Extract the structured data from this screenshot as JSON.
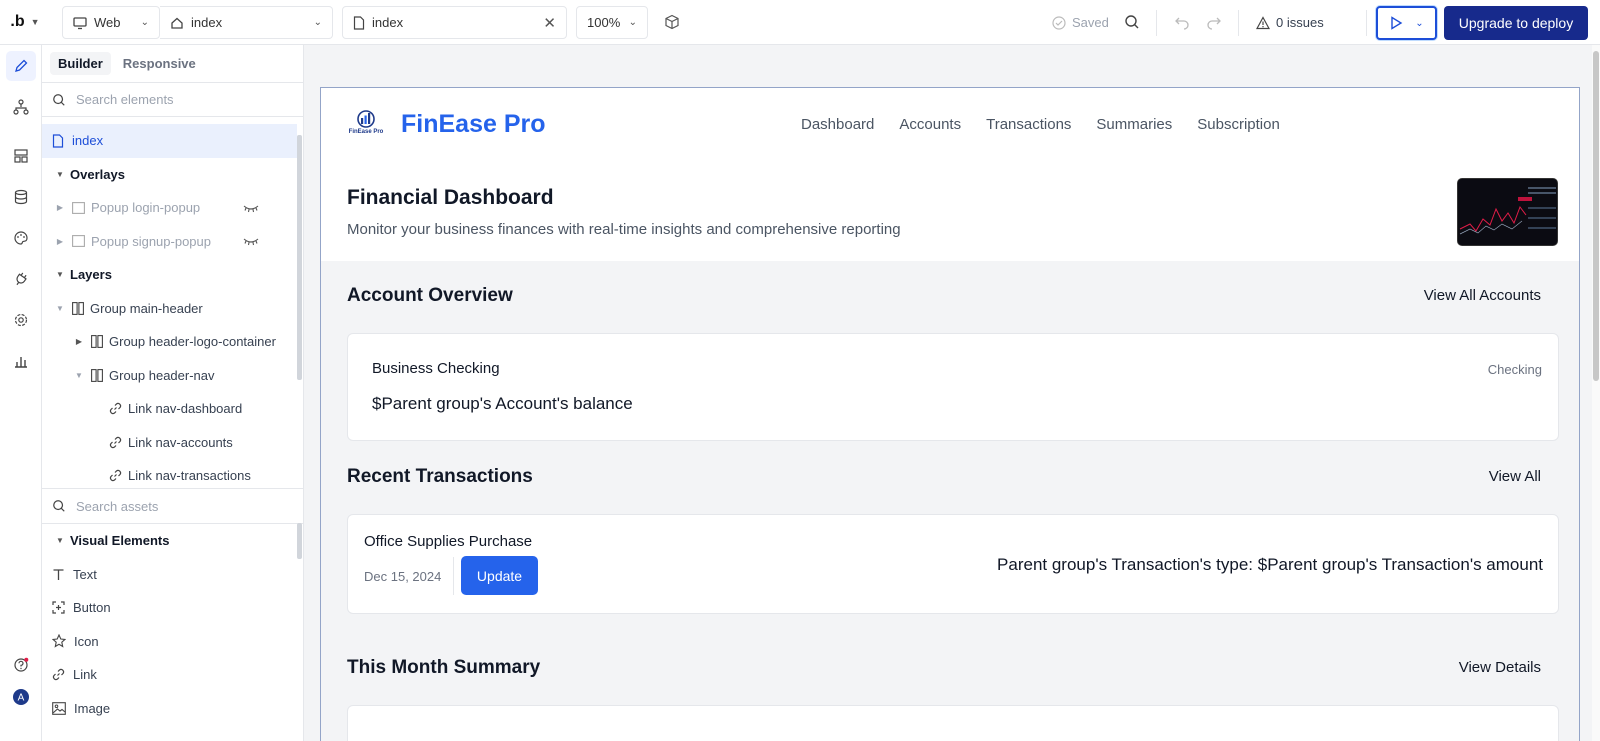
{
  "topbar": {
    "platform": "Web",
    "page_select": "index",
    "page_tab": "index",
    "zoom": "100%",
    "saved": "Saved",
    "issues": "0 issues",
    "deploy": "Upgrade to deploy"
  },
  "panel": {
    "tabs": [
      "Builder",
      "Responsive"
    ],
    "search_placeholder": "Search elements",
    "index": "index",
    "overlays": "Overlays",
    "popup_login": "Popup login-popup",
    "popup_signup": "Popup signup-popup",
    "layers": "Layers",
    "group_main_header": "Group main-header",
    "group_logo": "Group header-logo-container",
    "group_nav": "Group header-nav",
    "link_dashboard": "Link nav-dashboard",
    "link_accounts": "Link nav-accounts",
    "link_transactions": "Link nav-transactions",
    "assets_search_placeholder": "Search assets",
    "visual_elements": "Visual Elements",
    "assets": [
      "Text",
      "Button",
      "Icon",
      "Link",
      "Image"
    ]
  },
  "page": {
    "logo_caption": "FinEase Pro",
    "brand": "FinEase Pro",
    "nav": [
      "Dashboard",
      "Accounts",
      "Transactions",
      "Summaries",
      "Subscription"
    ],
    "hero_title": "Financial Dashboard",
    "hero_subtitle": "Monitor your business finances with real-time insights and comprehensive reporting",
    "account_overview": "Account Overview",
    "view_all_accounts": "View All Accounts",
    "account_name": "Business Checking",
    "account_type": "Checking",
    "account_balance": "$Parent group's Account's balance",
    "recent_transactions": "Recent Transactions",
    "view_all": "View All",
    "txn_name": "Office Supplies Purchase",
    "txn_date": "Dec 15, 2024",
    "update": "Update",
    "txn_amount": "Parent group's Transaction's type: $Parent group's Transaction's amount",
    "month_summary": "This Month Summary",
    "view_details": "View Details"
  },
  "colors": {
    "brand_blue": "#2563eb",
    "deploy_navy": "#172a8c"
  }
}
